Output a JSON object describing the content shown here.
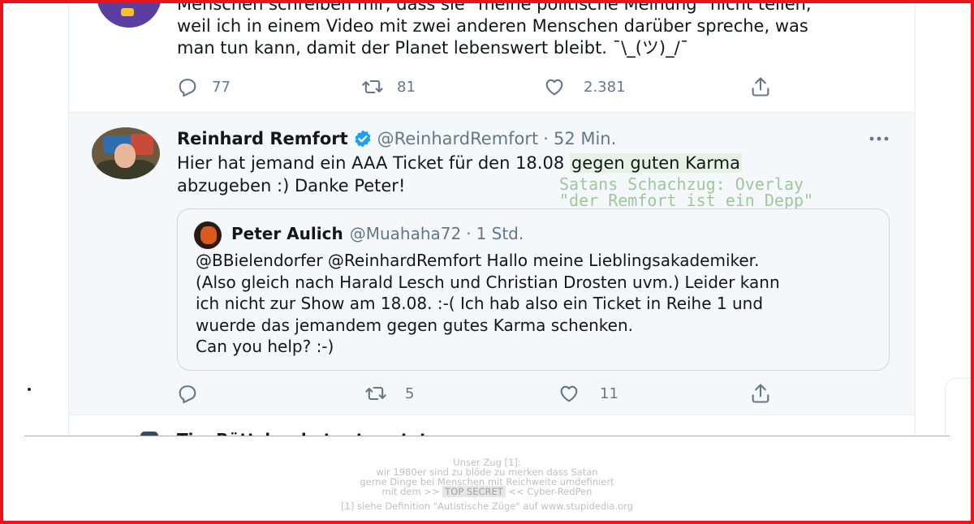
{
  "top_tweet": {
    "lines": [
      "Menschen schreiben mir, dass sie \"meine politische Meinung\" nicht teilen,",
      "weil ich in einem Video mit zwei anderen Menschen darüber spreche, was",
      "man tun kann, damit der Planet lebenswert bleibt. ¯\\_(ツ)_/¯"
    ],
    "actions": {
      "replies": "77",
      "retweets": "81",
      "likes": "2.381"
    }
  },
  "main_tweet": {
    "name": "Reinhard Remfort",
    "handle": "@ReinhardRemfort",
    "separator": "·",
    "time": "52 Min.",
    "text_line1_pre": "Hier hat jemand ein AAA Ticket für den 18.08 ",
    "text_line1_highlight": "gegen guten Karma",
    "text_line2": "abzugeben :) Danke Peter!",
    "overlay_lines": [
      "Satans Schachzug: Overlay",
      "\"der Remfort ist ein Depp\""
    ],
    "quote": {
      "name": "Peter Aulich",
      "handle": "@Muahaha72",
      "separator": "·",
      "time": "1 Std.",
      "lines": [
        "@BBielendorfer @ReinhardRemfort Hallo meine Lieblingsakademiker.",
        "(Also gleich nach Harald Lesch und Christian Drosten uvm.) Leider kann",
        "ich nicht zur Show am 18.08. :-( Ich hab also ein Ticket in Reihe 1 und",
        "wuerde das jemandem gegen gutes Karma schenken.",
        "Can you help? :-)"
      ]
    },
    "actions": {
      "replies": "",
      "retweets": "5",
      "likes": "11"
    }
  },
  "next_tweet": {
    "name": "Tim Böttcher hat retweetet"
  },
  "footer": {
    "line1": "Unser Zug [1]:",
    "line2": "wir 1980er sind zu blöde zu merken dass Satan",
    "line3": "gerne Dinge bei Menschen mit Reichweite umdefiniert",
    "line4_pre": "mit dem >> ",
    "line4_secret": "TOP SECRET",
    "line4_post": " << Cyber-RedPen",
    "note": "[1] siehe Definition \"Autistische Züge\" auf www.stupidedia.org"
  },
  "colors": {
    "frame": "#e8161c",
    "verified": "#1da1f2",
    "highlight": "#e7f2e4",
    "overlay_text": "#9fc79a",
    "muted": "#657786"
  }
}
